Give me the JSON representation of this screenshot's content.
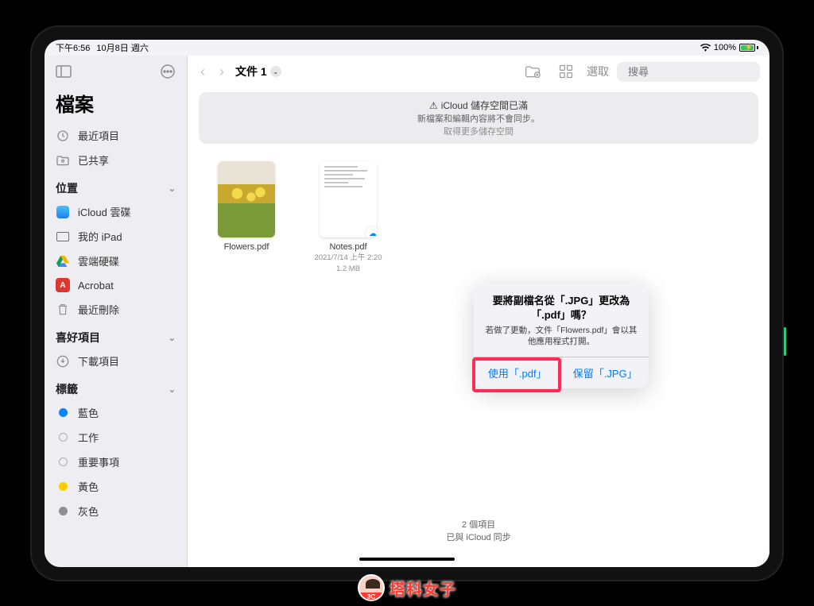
{
  "statusbar": {
    "time": "下午6:56",
    "date": "10月8日 週六",
    "battery_percent": "100%"
  },
  "sidebar": {
    "app_title": "檔案",
    "recent": "最近項目",
    "shared": "已共享",
    "sections": {
      "locations": "位置",
      "favorites": "喜好項目",
      "tags": "標籤"
    },
    "locations": {
      "icloud": "iCloud 雲碟",
      "my_ipad": "我的 iPad",
      "gdrive": "雲端硬碟",
      "acrobat": "Acrobat",
      "trash": "最近刪除"
    },
    "favorites": {
      "downloads": "下載項目"
    },
    "tags": {
      "blue": "藍色",
      "work": "工作",
      "important": "重要事項",
      "yellow": "黃色",
      "gray": "灰色"
    }
  },
  "toolbar": {
    "title": "文件 1",
    "select": "選取",
    "search_placeholder": "搜尋"
  },
  "notice": {
    "title": "iCloud 儲存空間已滿",
    "line2": "新檔案和編輯內容將不會同步。",
    "link": "取得更多儲存空間"
  },
  "files": [
    {
      "name": "Flowers.pdf",
      "date": "",
      "size": ""
    },
    {
      "name": "Notes.pdf",
      "date": "2021/7/14 上午 2:20",
      "size": "1.2 MB"
    }
  ],
  "footer": {
    "count": "2 個項目",
    "sync": "已與 iCloud 同步"
  },
  "dialog": {
    "title": "要將副檔名從「.JPG」更改為「.pdf」嗎？",
    "message": "若做了更動，文件「Flowers.pdf」會以其他應用程式打開。",
    "confirm": "使用「.pdf」",
    "cancel": "保留「.JPG」"
  },
  "watermark": {
    "text": "塔科女子"
  }
}
